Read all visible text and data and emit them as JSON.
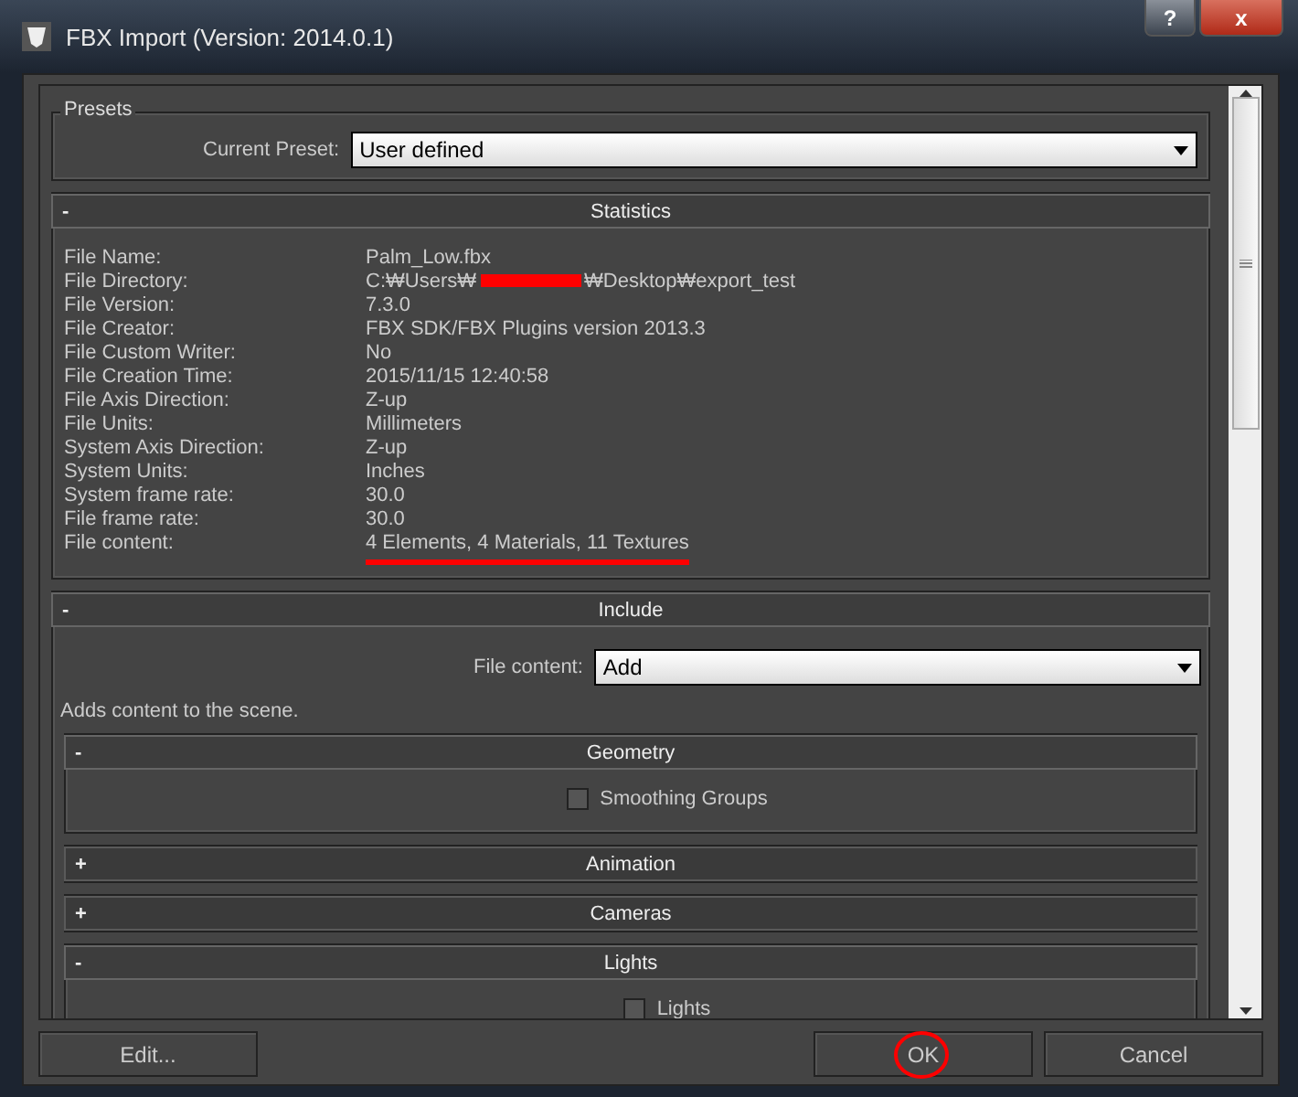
{
  "window": {
    "title": "FBX Import (Version: 2014.0.1)",
    "controls": [
      {
        "kind": "help",
        "label": "?"
      },
      {
        "kind": "close",
        "label": "x"
      }
    ]
  },
  "presets": {
    "legend": "Presets",
    "label": "Current Preset:",
    "value": "User defined"
  },
  "statistics": {
    "title": "Statistics",
    "expanded": true,
    "toggle": "-",
    "rows": [
      {
        "kind": "plain",
        "label": "File Name:",
        "value": "Palm_Low.fbx"
      },
      {
        "kind": "redacted",
        "label": "File Directory:",
        "value": "C:₩Users₩",
        "value_end": "₩Desktop₩export_test"
      },
      {
        "kind": "plain",
        "label": "File Version:",
        "value": "7.3.0"
      },
      {
        "kind": "plain",
        "label": "File Creator:",
        "value": "FBX SDK/FBX Plugins version 2013.3"
      },
      {
        "kind": "plain",
        "label": "File Custom Writer:",
        "value": "No"
      },
      {
        "kind": "plain",
        "label": "File Creation Time:",
        "value": "2015/11/15  12:40:58"
      },
      {
        "kind": "plain",
        "label": "File Axis Direction:",
        "value": "Z-up"
      },
      {
        "kind": "plain",
        "label": "File Units:",
        "value": "Millimeters"
      },
      {
        "kind": "plain",
        "label": "System Axis Direction:",
        "value": "Z-up"
      },
      {
        "kind": "plain",
        "label": "System Units:",
        "value": "Inches"
      },
      {
        "kind": "plain",
        "label": "System frame rate:",
        "value": "30.0"
      },
      {
        "kind": "plain",
        "label": "File frame rate:",
        "value": "30.0"
      },
      {
        "kind": "underlined",
        "label": "File content:",
        "value": "4 Elements,   4 Materials,   11 Textures"
      }
    ]
  },
  "include": {
    "title": "Include",
    "expanded": true,
    "toggle": "-",
    "field_label": "File content:",
    "field_value": "Add",
    "hint": "Adds content to the scene.",
    "groups": [
      {
        "title": "Geometry",
        "toggle": "-",
        "expanded": true,
        "options": [
          {
            "label": "Smoothing Groups",
            "checked": false
          }
        ]
      },
      {
        "title": "Animation",
        "toggle": "+",
        "expanded": false
      },
      {
        "title": "Cameras",
        "toggle": "+",
        "expanded": false
      },
      {
        "title": "Lights",
        "toggle": "-",
        "expanded": true,
        "options": [
          {
            "label": "Lights",
            "checked": false
          }
        ]
      }
    ]
  },
  "buttons": [
    {
      "label": "Edit...",
      "circled": false
    },
    {
      "label": "OK",
      "circled": true
    },
    {
      "label": "Cancel",
      "circled": false
    }
  ]
}
